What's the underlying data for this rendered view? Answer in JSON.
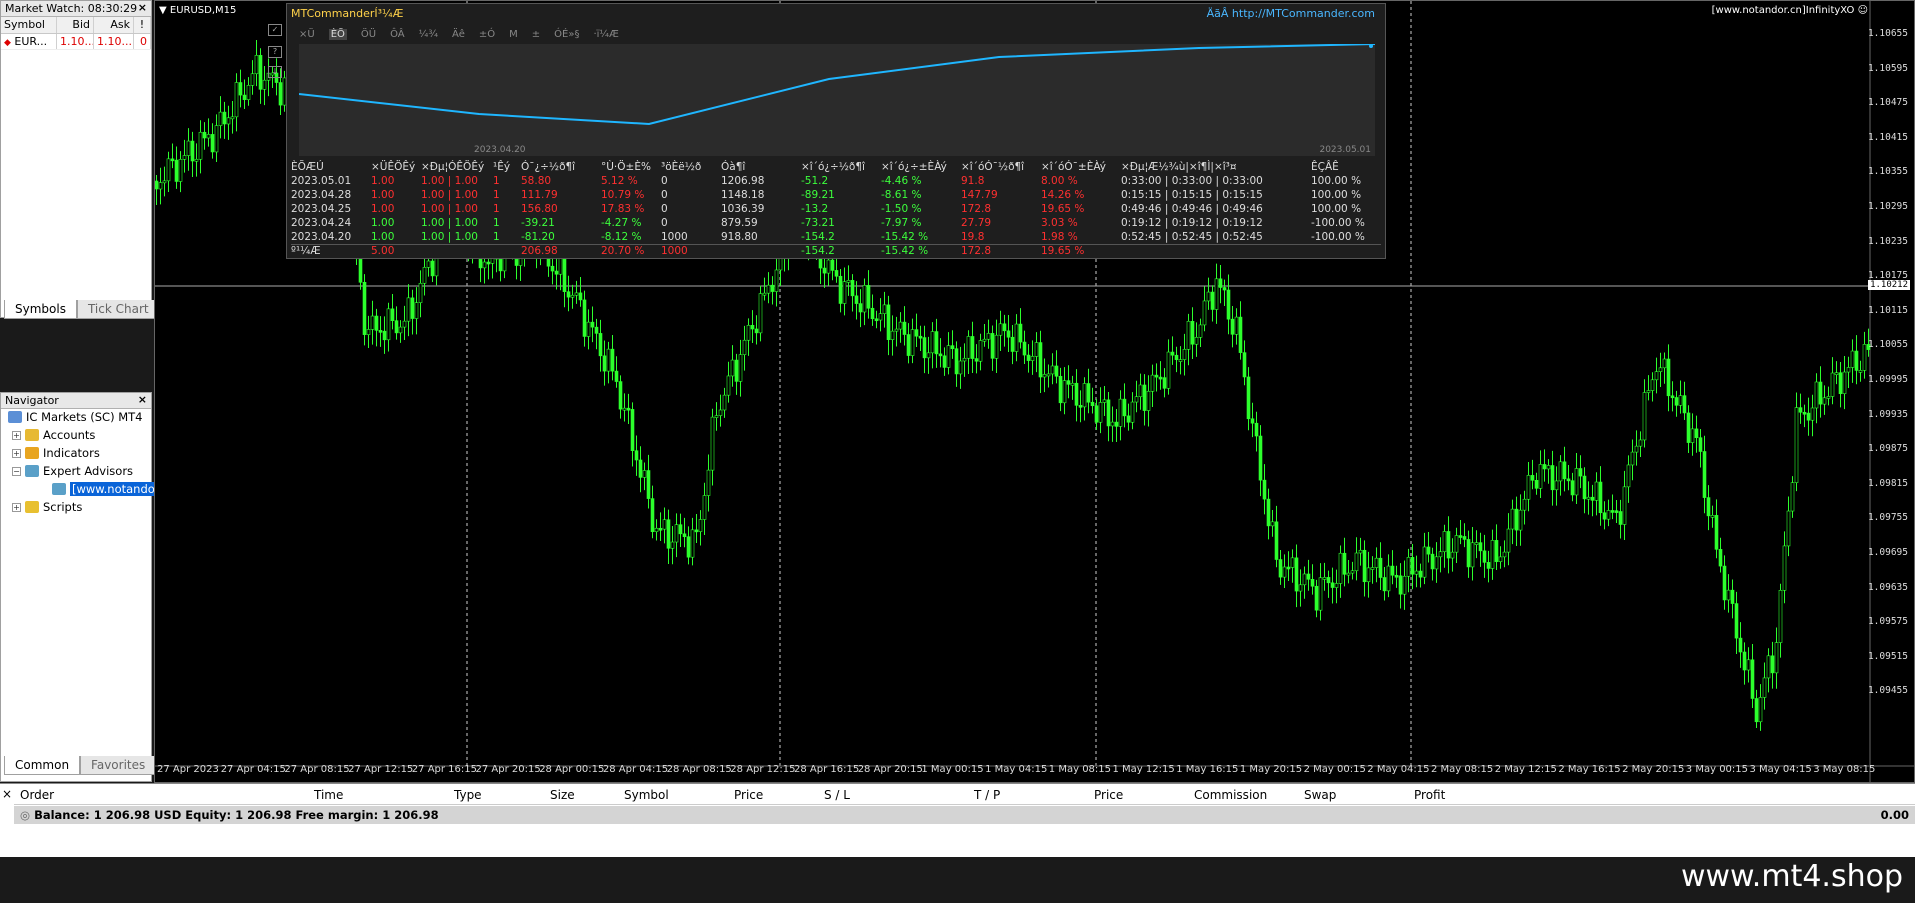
{
  "market_watch": {
    "title": "Market Watch: 08:30:29",
    "headers": [
      "Symbol",
      "Bid",
      "Ask",
      "!"
    ],
    "row": {
      "symbol": "EUR...",
      "bid": "1.10...",
      "ask": "1.10...",
      "spread": "0"
    },
    "tabs": [
      "Symbols",
      "Tick Chart"
    ]
  },
  "navigator": {
    "title": "Navigator",
    "root": "IC Markets (SC) MT4",
    "items": [
      "Accounts",
      "Indicators",
      "Expert Advisors",
      "[www.notandor.cn]Ir",
      "Scripts"
    ],
    "tabs": [
      "Common",
      "Favorites"
    ]
  },
  "chart": {
    "symbol": "EURUSD,M15",
    "ea_label": "[www.notandor.cn]InfinityXO",
    "current_price": "1.10212",
    "prices": [
      "1.10655",
      "1.10595",
      "1.10475",
      "1.10415",
      "1.10355",
      "1.10295",
      "1.10235",
      "1.10175",
      "1.10115",
      "1.10055",
      "1.09995",
      "1.09935",
      "1.09875",
      "1.09815",
      "1.09755",
      "1.09695",
      "1.09635",
      "1.09575",
      "1.09515",
      "1.09455"
    ],
    "times": [
      "27 Apr 2023",
      "27 Apr 04:15",
      "27 Apr 08:15",
      "27 Apr 12:15",
      "27 Apr 16:15",
      "27 Apr 20:15",
      "28 Apr 00:15",
      "28 Apr 04:15",
      "28 Apr 08:15",
      "28 Apr 12:15",
      "28 Apr 16:15",
      "28 Apr 20:15",
      "1 May 00:15",
      "1 May 04:15",
      "1 May 08:15",
      "1 May 12:15",
      "1 May 16:15",
      "1 May 20:15",
      "2 May 00:15",
      "2 May 04:15",
      "2 May 08:15",
      "2 May 12:15",
      "2 May 16:15",
      "2 May 20:15",
      "3 May 00:15",
      "3 May 04:15",
      "3 May 08:15"
    ]
  },
  "mtc": {
    "title": "MTCommanderÍ³¼Æ",
    "link": "ÄãÂ http://MTCommander.com",
    "toolbar": [
      "×Ü",
      "ÈÕ",
      "ÖÜ",
      "ÔÂ",
      "¼¾",
      "Äê",
      "±Ó",
      "M",
      "±",
      "ÓÉ»§",
      "·ï¼Æ"
    ],
    "graph_start": "2023.04.20",
    "graph_end": "2023.05.01",
    "headers": [
      "ÈÕÆÚ",
      "×ÜÊÖÊý",
      "×Ðµ¦ÓÊÖÊý",
      "¹Êý",
      "Ó¯¿÷½ð¶î",
      "°Ù·Ö±È%",
      "³öÈë½ð",
      "Óà¶î",
      "×î´ó¿÷½ð¶î",
      "×î´ó¿÷±ÈÀý",
      "×î´óÓ¯½ð¶î",
      "×î´óÓ¯±ÈÀý",
      "×Ðµ¦Æ½¾ù|×î¶Ì|×î³¤",
      "ÊÇÂÊ"
    ],
    "rows": [
      [
        "2023.05.01",
        "1.00",
        "1.00 | 1.00",
        "1",
        "58.80",
        "5.12 %",
        "0",
        "1206.98",
        "-51.2",
        "-4.46 %",
        "91.8",
        "8.00 %",
        "0:33:00 | 0:33:00 | 0:33:00",
        "100.00 %"
      ],
      [
        "2023.04.28",
        "1.00",
        "1.00 | 1.00",
        "1",
        "111.79",
        "10.79 %",
        "0",
        "1148.18",
        "-89.21",
        "-8.61 %",
        "147.79",
        "14.26 %",
        "0:15:15 | 0:15:15 | 0:15:15",
        "100.00 %"
      ],
      [
        "2023.04.25",
        "1.00",
        "1.00 | 1.00",
        "1",
        "156.80",
        "17.83 %",
        "0",
        "1036.39",
        "-13.2",
        "-1.50 %",
        "172.8",
        "19.65 %",
        "0:49:46 | 0:49:46 | 0:49:46",
        "100.00 %"
      ],
      [
        "2023.04.24",
        "1.00",
        "1.00 | 1.00",
        "1",
        "-39.21",
        "-4.27 %",
        "0",
        "879.59",
        "-73.21",
        "-7.97 %",
        "27.79",
        "3.03 %",
        "0:19:12 | 0:19:12 | 0:19:12",
        "-100.00 %"
      ],
      [
        "2023.04.20",
        "1.00",
        "1.00 | 1.00",
        "1",
        "-81.20",
        "-8.12 %",
        "1000",
        "918.80",
        "-154.2",
        "-15.42 %",
        "19.8",
        "1.98 %",
        "0:52:45 | 0:52:45 | 0:52:45",
        "-100.00 %"
      ]
    ],
    "total": [
      "º¹¼Æ",
      "5.00",
      "",
      "",
      "206.98",
      "20.70 %",
      "1000",
      "",
      "-154.2",
      "-15.42 %",
      "172.8",
      "19.65 %",
      "",
      ""
    ]
  },
  "terminal": {
    "headers": [
      "Order",
      "Time",
      "Type",
      "Size",
      "Symbol",
      "Price",
      "S / L",
      "T / P",
      "Price",
      "Commission",
      "Swap",
      "Profit"
    ],
    "balance": "Balance: 1 206.98 USD  Equity: 1 206.98  Free margin: 1 206.98",
    "profit": "0.00"
  },
  "watermark": "www.mt4.shop"
}
